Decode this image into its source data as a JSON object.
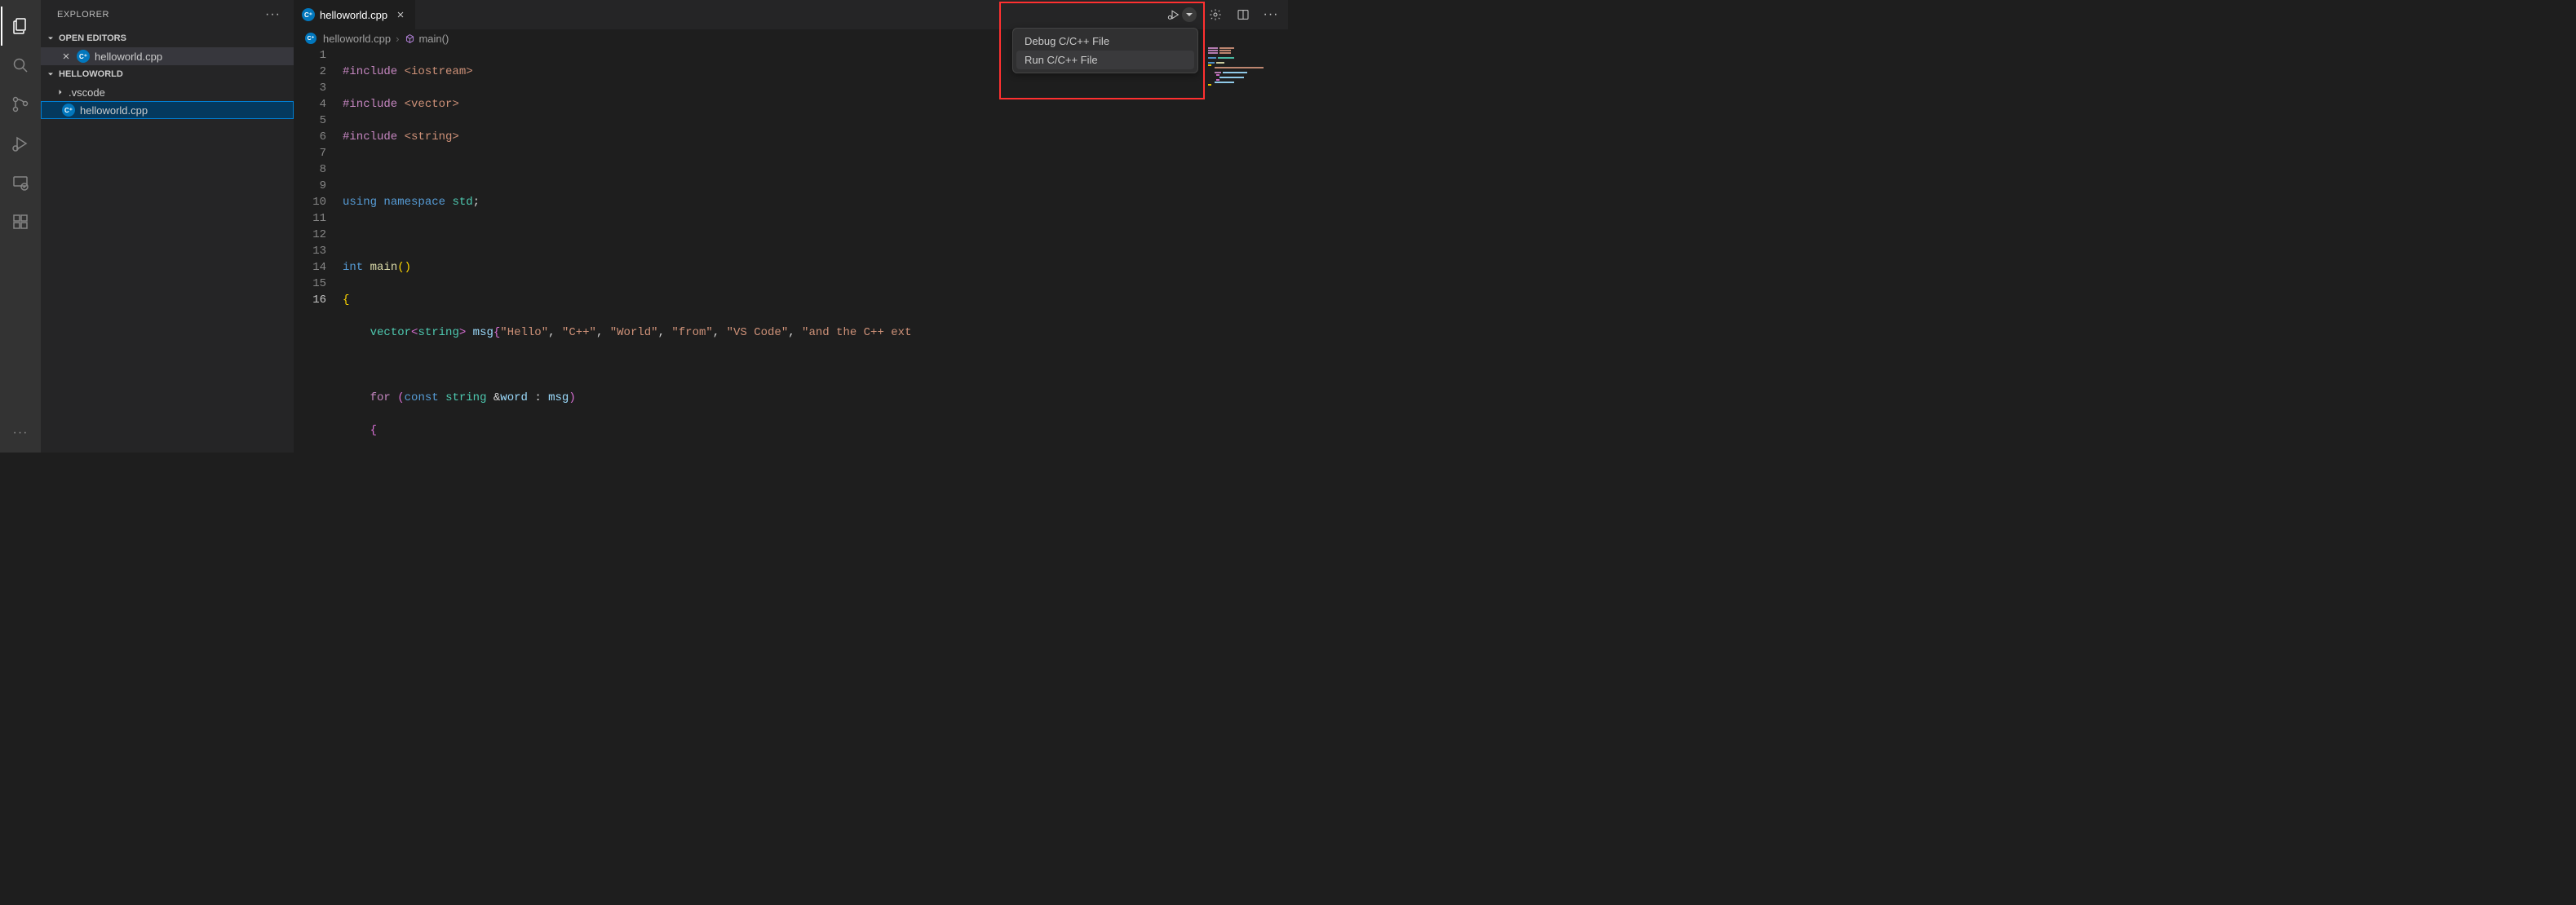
{
  "sidebar": {
    "title": "EXPLORER",
    "sections": {
      "openEditors": "OPEN EDITORS",
      "folder": "HELLOWORLD"
    },
    "openEditorItems": [
      {
        "label": "helloworld.cpp"
      }
    ],
    "tree": [
      {
        "label": ".vscode",
        "kind": "folder"
      },
      {
        "label": "helloworld.cpp",
        "kind": "file-cpp",
        "selected": true
      }
    ]
  },
  "tab": {
    "label": "helloworld.cpp"
  },
  "breadcrumbs": {
    "file": "helloworld.cpp",
    "symbol": "main()"
  },
  "runMenu": {
    "items": [
      "Debug C/C++ File",
      "Run C/C++ File"
    ]
  },
  "code": {
    "lines": 16
  },
  "icons": {
    "cpp_badge": "C⁺"
  }
}
